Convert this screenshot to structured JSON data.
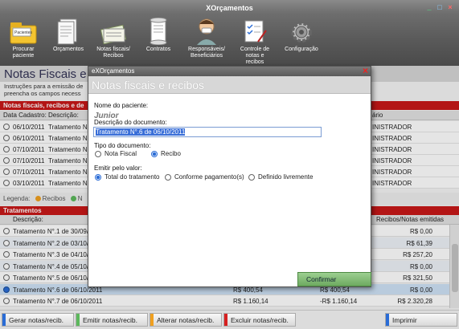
{
  "app": {
    "title": "XOrçamentos"
  },
  "toolbar": [
    {
      "label": "Procurar paciente",
      "icon": "folder-icon"
    },
    {
      "label": "Orçamentos",
      "icon": "documents-icon"
    },
    {
      "label": "Notas fiscais/ Recibos",
      "icon": "receipts-icon"
    },
    {
      "label": "Contratos",
      "icon": "contract-scroll-icon"
    },
    {
      "label": "Responsáveis/ Beneficiários",
      "icon": "person-mask-icon"
    },
    {
      "label": "Controle de notas e recibos",
      "icon": "checklist-icon"
    },
    {
      "label": "Configuração",
      "icon": "gear-icon"
    }
  ],
  "background": {
    "title": "Notas Fiscais e",
    "instructions_1": "Instruções para a emissão de",
    "instructions_2": "preencha os campos necess",
    "docs_section": "Notas fiscais, recibos e de",
    "docs_headers": {
      "date": "Data Cadastro:",
      "desc": "Descrição:",
      "user": "ário"
    },
    "docs_rows": [
      {
        "date": "06/10/2011",
        "desc": "Tratamento N°",
        "user": "INISTRADOR"
      },
      {
        "date": "06/10/2011",
        "desc": "Tratamento N°",
        "user": "INISTRADOR"
      },
      {
        "date": "07/10/2011",
        "desc": "Tratamento N°",
        "user": "INISTRADOR"
      },
      {
        "date": "07/10/2011",
        "desc": "Tratamento N°",
        "user": "INISTRADOR"
      },
      {
        "date": "07/10/2011",
        "desc": "Tratamento N°",
        "user": "INISTRADOR"
      },
      {
        "date": "03/10/2011",
        "desc": "Tratamento N°",
        "user": "INISTRADOR"
      }
    ],
    "legend": {
      "label": "Legenda:",
      "recibos": "Recibos",
      "n": "N"
    },
    "treat_section": "Tratamentos",
    "treat_headers": {
      "desc": "Descrição:",
      "emitted": "Recibos/Notas emitidas"
    },
    "treat_rows": [
      {
        "desc": "Tratamento N°.1 de 30/09/2",
        "v1": "",
        "v2": "",
        "emitted": "R$ 0,00"
      },
      {
        "desc": "Tratamento N°.2 de 03/10/2",
        "v1": "",
        "v2": "",
        "emitted": "R$ 61,39"
      },
      {
        "desc": "Tratamento N°.3 de 04/10/2",
        "v1": "",
        "v2": "",
        "emitted": "R$ 257,20"
      },
      {
        "desc": "Tratamento N°.4 de 05/10/2",
        "v1": "",
        "v2": "",
        "emitted": "R$ 0,00"
      },
      {
        "desc": "Tratamento N°.5 de 06/10/2",
        "v1": "",
        "v2": "",
        "emitted": "R$ 321,50"
      },
      {
        "desc": "Tratamento N°.6 de 06/10/2011",
        "v1": "R$ 400,54",
        "v2": "R$ 400,54",
        "emitted": "R$ 0,00"
      },
      {
        "desc": "Tratamento N°.7 de 06/10/2011",
        "v1": "R$ 1.160,14",
        "v2": "-R$ 1.160,14",
        "emitted": "R$ 2.320,28"
      }
    ]
  },
  "bottom_buttons": [
    {
      "label": "Gerar notas/recib.",
      "color": "#2a6cd6"
    },
    {
      "label": "Emitir notas/recib.",
      "color": "#5cb85c"
    },
    {
      "label": "Alterar notas/recib.",
      "color": "#f0a020"
    },
    {
      "label": "Excluir notas/recib.",
      "color": "#d62020"
    },
    {
      "label": "Imprimir",
      "color": "#2a6cd6"
    }
  ],
  "modal": {
    "window_title": "eXOrçamentos",
    "header": "Notas fiscais e recibos",
    "patient_label": "Nome do paciente:",
    "patient_name": "Junior",
    "desc_label": "Descrição do documento:",
    "desc_value": "Tratamento N°.6 de 06/10/2011",
    "doc_type_label": "Tipo do documento:",
    "doc_type_options": [
      "Nota Fiscal",
      "Recibo"
    ],
    "value_label": "Emitir pelo valor:",
    "value_options": [
      "Total do tratamento",
      "Conforme pagamento(s)",
      "Definido livremente"
    ],
    "confirm": "Confirmar"
  },
  "colors": {
    "accent_red": "#c81818",
    "selection_blue": "#3a6fd8",
    "confirm_green": "#6eaa60"
  }
}
